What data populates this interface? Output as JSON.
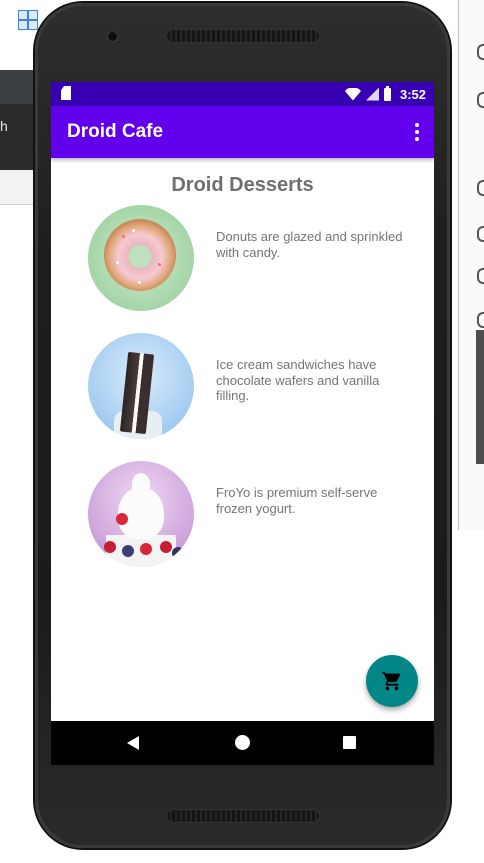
{
  "background": {
    "ide_partial_text": "h"
  },
  "status_bar": {
    "time": "3:52",
    "icons": [
      "sd-card-icon",
      "wifi-icon",
      "signal-icon",
      "battery-icon"
    ]
  },
  "app_bar": {
    "title": "Droid Cafe",
    "overflow_icon": "more-vert-icon"
  },
  "main": {
    "heading": "Droid Desserts",
    "desserts": [
      {
        "image": "donut-image",
        "description": "Donuts are glazed and sprinkled with candy."
      },
      {
        "image": "ice-cream-sandwich-image",
        "description": "Ice cream sandwiches have chocolate wafers and vanilla filling."
      },
      {
        "image": "froyo-image",
        "description": "FroYo is premium self-serve frozen yogurt."
      }
    ]
  },
  "fab": {
    "icon": "shopping-cart-icon",
    "color": "#018786"
  },
  "nav_bar": {
    "icons": [
      "back-icon",
      "home-icon",
      "recents-icon"
    ]
  },
  "colors": {
    "primary": "#6200ee",
    "primary_dark": "#3700b3",
    "accent": "#018786"
  }
}
